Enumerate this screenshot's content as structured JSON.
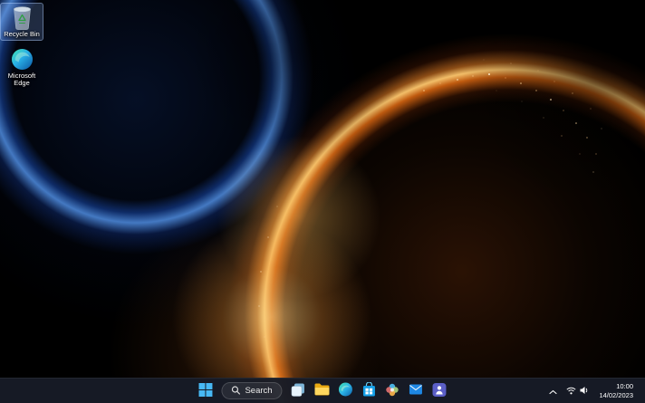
{
  "desktop": {
    "icons": [
      {
        "id": "recycle-bin",
        "label": "Recycle Bin",
        "selected": true
      },
      {
        "id": "microsoft-edge",
        "label": "Microsoft Edge",
        "selected": false
      }
    ]
  },
  "taskbar": {
    "start": {
      "icon": "windows-logo"
    },
    "search": {
      "label": "Search",
      "icon": "search-icon"
    },
    "apps": [
      {
        "id": "task-view",
        "icon": "task-view-icon"
      },
      {
        "id": "file-explorer",
        "icon": "folder-icon"
      },
      {
        "id": "microsoft-edge",
        "icon": "edge-icon"
      },
      {
        "id": "microsoft-store",
        "icon": "store-bag-icon"
      },
      {
        "id": "photos",
        "icon": "photos-icon"
      },
      {
        "id": "outlook",
        "icon": "envelope-icon"
      },
      {
        "id": "microsoft-teams",
        "icon": "teams-icon"
      }
    ],
    "tray": {
      "chevron_icon": "chevron-up-icon",
      "icons": [
        "network-icon",
        "volume-icon"
      ],
      "time": "10:00",
      "date": "14/02/2023"
    }
  },
  "colors": {
    "taskbar_bg": "#171b26",
    "selection": "rgba(140,180,255,0.22)",
    "wallpaper_blue": "#2468e0",
    "wallpaper_orange": "#ff8a1e",
    "accent": "#47b8f4"
  }
}
